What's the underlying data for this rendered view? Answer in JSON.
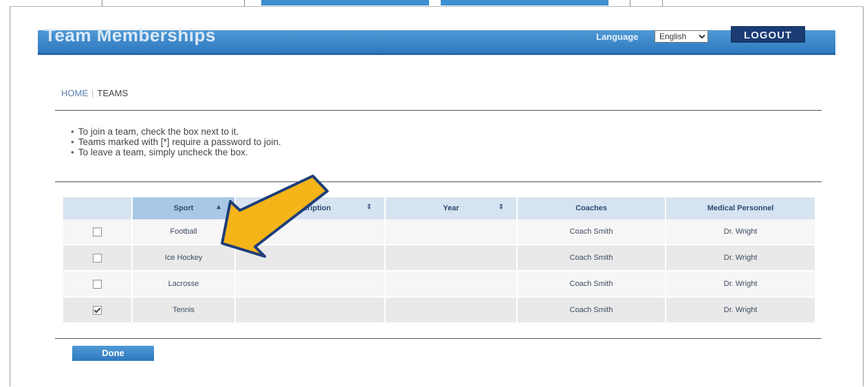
{
  "header": {
    "title": "Team Memberships",
    "language_label": "Language",
    "language_value": "English",
    "logout_label": "LOGOUT"
  },
  "breadcrumb": {
    "home": "HOME",
    "current": "TEAMS"
  },
  "instructions": [
    "To join a team, check the box next to it.",
    "Teams marked with [*] require a password to join.",
    "To leave a team, simply uncheck the box."
  ],
  "table": {
    "columns": [
      "Sport",
      "Description",
      "Year",
      "Coaches",
      "Medical Personnel"
    ],
    "rows": [
      {
        "sport": "Football",
        "description": "",
        "year": "",
        "coaches": "Coach Smith",
        "medical": "Dr. Wright",
        "checked": false
      },
      {
        "sport": "Ice Hockey",
        "description": "",
        "year": "",
        "coaches": "Coach Smith",
        "medical": "Dr. Wright",
        "checked": false
      },
      {
        "sport": "Lacrosse",
        "description": "",
        "year": "",
        "coaches": "Coach Smith",
        "medical": "Dr. Wright",
        "checked": false
      },
      {
        "sport": "Tennis",
        "description": "",
        "year": "",
        "coaches": "Coach Smith",
        "medical": "Dr. Wright",
        "checked": true
      }
    ]
  },
  "done_label": "Done",
  "colors": {
    "header_blue": "#3584c8",
    "logout_navy": "#1b3b73",
    "arrow_fill": "#f5b418",
    "arrow_stroke": "#1f3f7a"
  }
}
